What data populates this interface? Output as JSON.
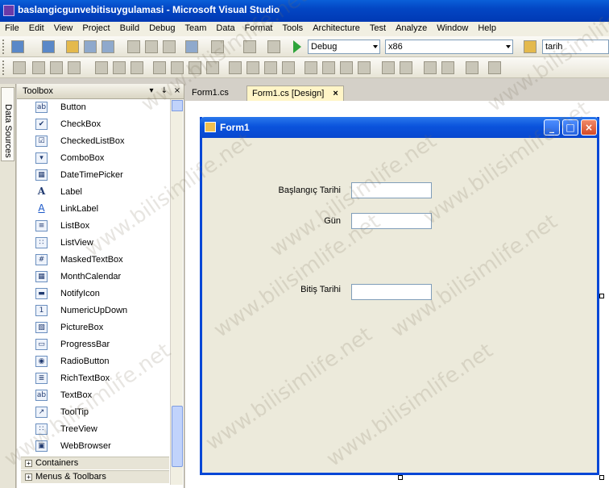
{
  "window": {
    "title": "baslangicgunvebitisuygulamasi - Microsoft Visual Studio"
  },
  "menu": [
    "File",
    "Edit",
    "View",
    "Project",
    "Build",
    "Debug",
    "Team",
    "Data",
    "Format",
    "Tools",
    "Architecture",
    "Test",
    "Analyze",
    "Window",
    "Help"
  ],
  "toolbar": {
    "config_value": "Debug",
    "platform_value": "x86",
    "find_value": "tarih"
  },
  "data_sources": {
    "label": "Data Sources"
  },
  "toolbox": {
    "title": "Toolbox",
    "pin": "↓",
    "close": "×",
    "items": [
      {
        "label": "Button",
        "icon": "ab"
      },
      {
        "label": "CheckBox",
        "icon": "✔"
      },
      {
        "label": "CheckedListBox",
        "icon": "☑"
      },
      {
        "label": "ComboBox",
        "icon": "▾"
      },
      {
        "label": "DateTimePicker",
        "icon": "▦"
      },
      {
        "label": "Label",
        "icon": "A"
      },
      {
        "label": "LinkLabel",
        "icon": "A"
      },
      {
        "label": "ListBox",
        "icon": "≡"
      },
      {
        "label": "ListView",
        "icon": "∷"
      },
      {
        "label": "MaskedTextBox",
        "icon": "#"
      },
      {
        "label": "MonthCalendar",
        "icon": "▦"
      },
      {
        "label": "NotifyIcon",
        "icon": "▬"
      },
      {
        "label": "NumericUpDown",
        "icon": "1"
      },
      {
        "label": "PictureBox",
        "icon": "▧"
      },
      {
        "label": "ProgressBar",
        "icon": "▭"
      },
      {
        "label": "RadioButton",
        "icon": "◉"
      },
      {
        "label": "RichTextBox",
        "icon": "≣"
      },
      {
        "label": "TextBox",
        "icon": "ab"
      },
      {
        "label": "ToolTip",
        "icon": "↗"
      },
      {
        "label": "TreeView",
        "icon": "∷"
      },
      {
        "label": "WebBrowser",
        "icon": "▣"
      }
    ],
    "groups": [
      "Containers",
      "Menus & Toolbars"
    ],
    "expand_glyph": "+"
  },
  "tabs": [
    {
      "label": "Form1.cs"
    },
    {
      "label": "Form1.cs [Design]",
      "close": "×"
    }
  ],
  "form": {
    "title": "Form1",
    "minimize": "_",
    "maximize": "□",
    "close": "×",
    "labels": {
      "start_date": "Başlangıç Tarihi",
      "days": "Gün",
      "end_date": "Bitiş Tarihi"
    }
  },
  "watermark_text": "www.bilisimlife.net",
  "colors": {
    "title_blue": "#0346c4",
    "form_back": "#eceadb",
    "active_tab": "#fff5c7"
  }
}
